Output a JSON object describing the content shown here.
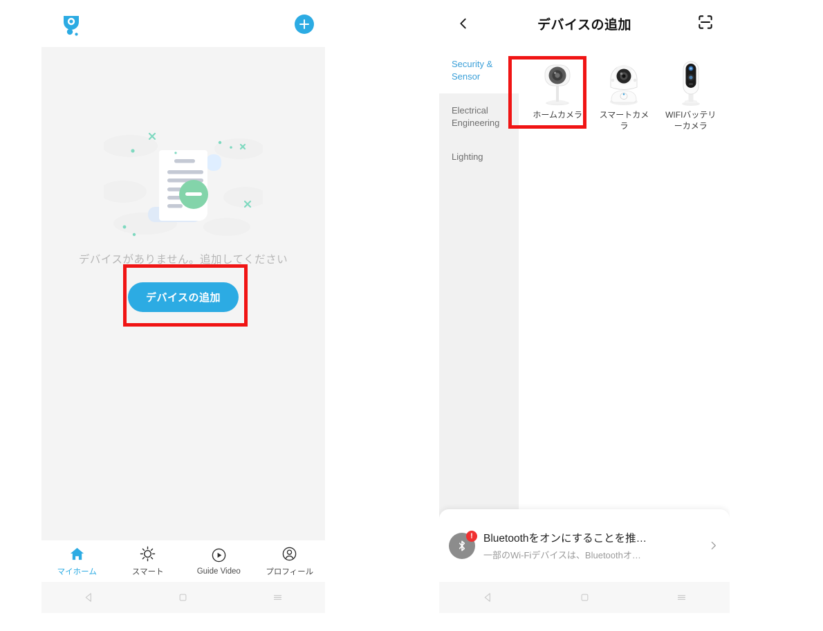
{
  "left_screen": {
    "appbar": {
      "logo_icon": "app-logo-shield-camera",
      "add_icon": "plus-circle-icon"
    },
    "empty_state": {
      "illustration_icon": "empty-document-illustration",
      "message": "デバイスがありません。追加してください",
      "cta_label": "デバイスの追加"
    },
    "tabs": [
      {
        "label": "マイホーム",
        "icon": "home-icon",
        "active": true
      },
      {
        "label": "スマート",
        "icon": "sun-icon",
        "active": false
      },
      {
        "label": "Guide Video",
        "icon": "play-circle-icon",
        "active": false
      },
      {
        "label": "プロフィール",
        "icon": "person-circle-icon",
        "active": false
      }
    ],
    "system_nav": [
      {
        "icon": "android-back-icon"
      },
      {
        "icon": "android-home-icon"
      },
      {
        "icon": "android-recents-icon"
      }
    ]
  },
  "right_screen": {
    "header": {
      "back_icon": "chevron-left-icon",
      "title": "デバイスの追加",
      "scan_icon": "qr-scan-icon"
    },
    "categories": [
      {
        "label": "Security & Sensor",
        "active": true
      },
      {
        "label": "Electrical Engineering",
        "active": false
      },
      {
        "label": "Lighting",
        "active": false
      }
    ],
    "devices": [
      {
        "name": "ホームカメラ",
        "icon": "home-camera-device",
        "highlighted": true
      },
      {
        "name": "スマートカメラ",
        "icon": "pan-tilt-camera-device",
        "highlighted": false
      },
      {
        "name": "WIFIバッテリーカメラ",
        "icon": "wifi-battery-camera-device",
        "highlighted": false
      }
    ],
    "bluetooth_banner": {
      "icon": "bluetooth-icon",
      "badge": "!",
      "title": "Bluetoothをオンにすることを推…",
      "subtitle": "一部のWi-Fiデバイスは、Bluetoothオ…",
      "chevron_icon": "chevron-right-icon"
    },
    "system_nav": [
      {
        "icon": "android-back-icon"
      },
      {
        "icon": "android-home-icon"
      },
      {
        "icon": "android-recents-icon"
      }
    ]
  },
  "annotations": [
    {
      "name": "add-device-button-highlight",
      "color": "#f01414"
    },
    {
      "name": "home-camera-highlight",
      "color": "#f01414"
    }
  ],
  "theme": {
    "accent": "#2cabe3",
    "annotation": "#f01414",
    "page_bg": "#f4f4f4"
  }
}
